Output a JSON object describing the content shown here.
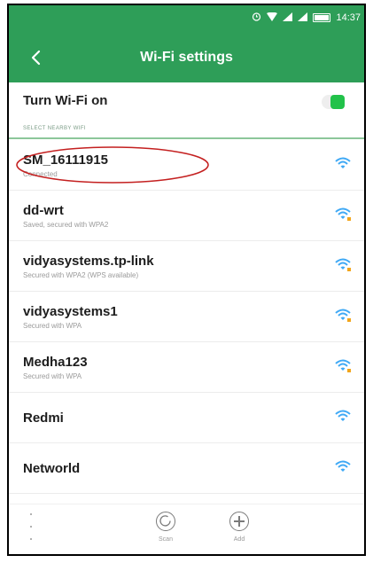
{
  "status_bar": {
    "time": "14:37",
    "icons": [
      "alarm-icon",
      "wifi-signal-icon",
      "cell-signal-icon",
      "cell-signal-icon",
      "battery-icon"
    ]
  },
  "header": {
    "back_icon": "back-chevron-icon",
    "title": "Wi-Fi settings",
    "background": "#2e9e58"
  },
  "wifi_toggle": {
    "label": "Turn Wi-Fi on",
    "state": "on",
    "accent": "#22c24a"
  },
  "section_label": "SELECT NEARBY WIFI",
  "networks": [
    {
      "name": "SM_16111915",
      "status": "Connected",
      "icon": "wifi-icon",
      "secured": false,
      "highlighted": true
    },
    {
      "name": "dd-wrt",
      "status": "Saved, secured with WPA2",
      "icon": "wifi-lock-icon",
      "secured": true
    },
    {
      "name": "vidyasystems.tp-link",
      "status": "Secured with WPA2 (WPS available)",
      "icon": "wifi-lock-icon",
      "secured": true
    },
    {
      "name": "vidyasystems1",
      "status": "Secured with WPA",
      "icon": "wifi-lock-icon",
      "secured": true
    },
    {
      "name": "Medha123",
      "status": "Secured with WPA",
      "icon": "wifi-lock-icon",
      "secured": true
    },
    {
      "name": "Redmi",
      "status": "",
      "icon": "wifi-icon",
      "secured": false
    },
    {
      "name": "Networld",
      "status": "",
      "icon": "wifi-icon",
      "secured": false
    }
  ],
  "bottom_bar": {
    "more_icon": "more-vertical-icon",
    "scan_label": "Scan",
    "add_label": "Add"
  },
  "colors": {
    "wifi_icon": "#3fa9f5",
    "lock_badge": "#f2a51a",
    "highlight_ellipse": "#c42020"
  }
}
